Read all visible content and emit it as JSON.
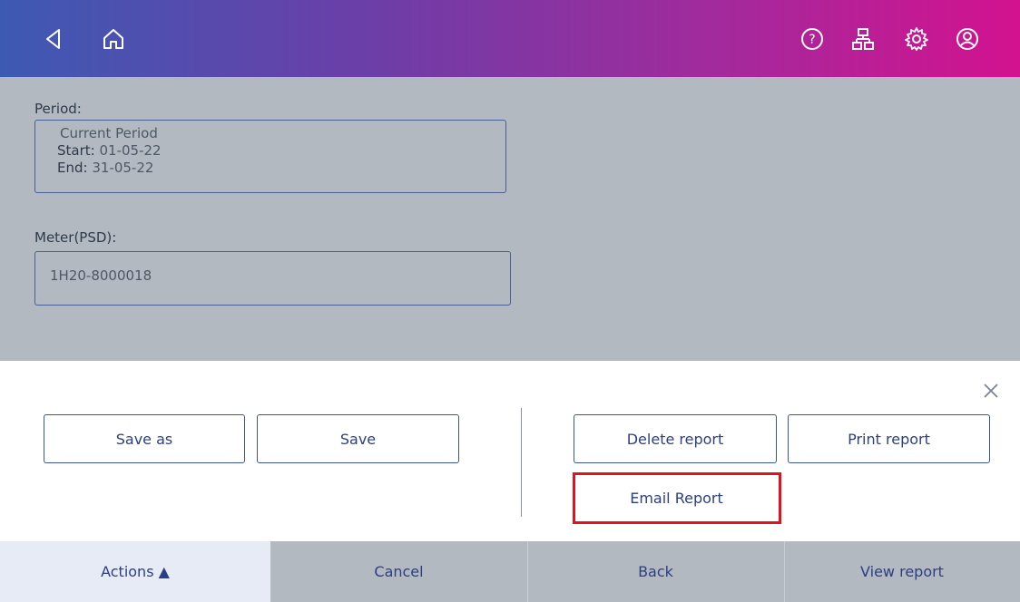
{
  "header": {
    "icons": [
      "back-icon",
      "home-icon",
      "help-icon",
      "network-icon",
      "settings-icon",
      "account-icon"
    ],
    "gradient_start": "#3d5ab3",
    "gradient_end": "#d3128f"
  },
  "form": {
    "period_label": "Period:",
    "period_name": "Current Period",
    "start_key": "Start:",
    "start_value": "01-05-22",
    "end_key": "End:",
    "end_value": "31-05-22",
    "meter_label": "Meter(PSD):",
    "meter_value": "1H20-8000018"
  },
  "actions": {
    "save_as": "Save as",
    "save": "Save",
    "delete_report": "Delete report",
    "print_report": "Print report",
    "email_report": "Email Report",
    "highlight_color": "#e0131e"
  },
  "tabs": {
    "actions": "Actions ▲",
    "cancel": "Cancel",
    "back": "Back",
    "view_report": "View report"
  }
}
